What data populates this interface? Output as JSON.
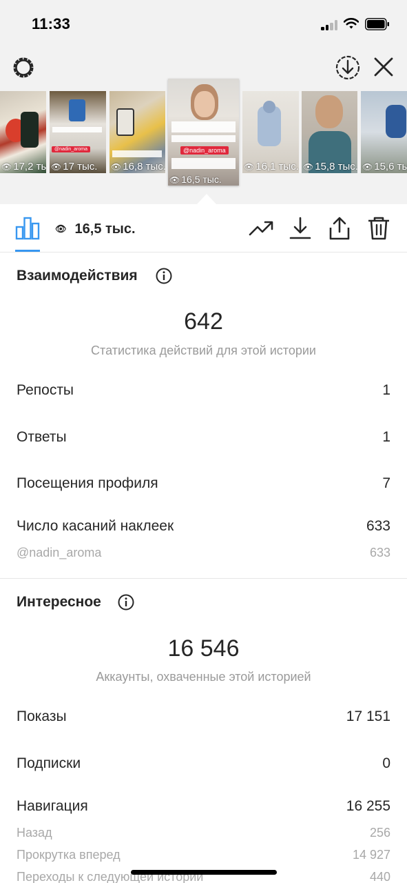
{
  "status_bar": {
    "time": "11:33"
  },
  "thumbnails": [
    {
      "views": "17,2 тыс."
    },
    {
      "views": "17 тыс.",
      "tag": "@nadin_aroma"
    },
    {
      "views": "16,8 тыс."
    },
    {
      "views": "16,5 тыс.",
      "tag": "@nadin_aroma",
      "selected": true
    },
    {
      "views": "16,1 тыс."
    },
    {
      "views": "15,8 тыс."
    },
    {
      "views": "15,6 тыс."
    }
  ],
  "toolbar": {
    "views_label": "16,5 тыс.",
    "icons": [
      "bar-chart-icon",
      "trending-icon",
      "download-icon",
      "share-icon",
      "trash-icon"
    ]
  },
  "interactions": {
    "title": "Взаимодействия",
    "total": "642",
    "caption": "Статистика действий для этой истории",
    "rows": [
      {
        "label": "Репосты",
        "value": "1"
      },
      {
        "label": "Ответы",
        "value": "1"
      },
      {
        "label": "Посещения профиля",
        "value": "7"
      },
      {
        "label": "Число касаний наклеек",
        "value": "633"
      }
    ],
    "sticker_sub": {
      "label": "@nadin_aroma",
      "value": "633"
    }
  },
  "discovery": {
    "title": "Интересное",
    "total": "16 546",
    "caption": "Аккаунты, охваченные этой историей",
    "rows": [
      {
        "label": "Показы",
        "value": "17 151"
      },
      {
        "label": "Подписки",
        "value": "0"
      },
      {
        "label": "Навигация",
        "value": "16 255"
      }
    ],
    "navigation_sub": [
      {
        "label": "Назад",
        "value": "256"
      },
      {
        "label": "Прокрутка вперед",
        "value": "14 927"
      },
      {
        "label": "Переходы к следующей истории",
        "value": "440"
      }
    ]
  },
  "colors": {
    "accent": "#3897f0",
    "tag_red": "#e0283c",
    "muted_text": "#9a9a9a"
  }
}
